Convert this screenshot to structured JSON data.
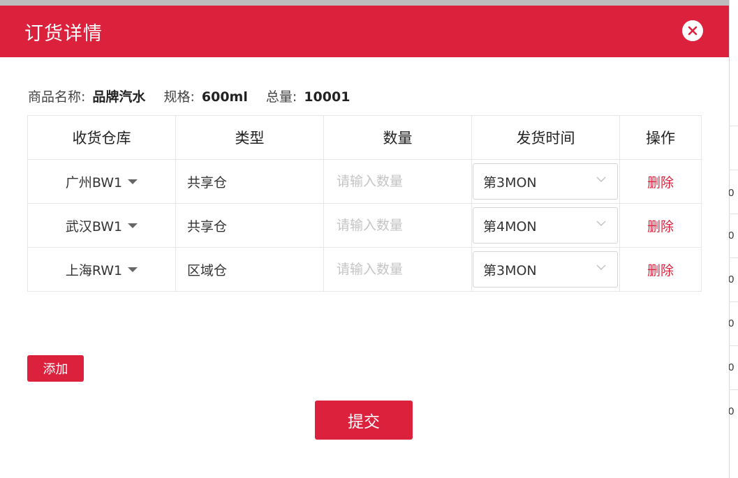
{
  "dialog": {
    "title": "订货详情"
  },
  "product": {
    "name_label": "商品名称:",
    "name_value": "品牌汽水",
    "spec_label": "规格:",
    "spec_value": "600ml",
    "total_label": "总量:",
    "total_value": "10001"
  },
  "table": {
    "headers": [
      "收货仓库",
      "类型",
      "数量",
      "发货时间",
      "操作"
    ],
    "rows": [
      {
        "warehouse": "广州BW1",
        "type": "共享仓",
        "qty_placeholder": "请输入数量",
        "ship_time": "第3MON",
        "action": "删除"
      },
      {
        "warehouse": "武汉BW1",
        "type": "共享仓",
        "qty_placeholder": "请输入数量",
        "ship_time": "第4MON",
        "action": "删除"
      },
      {
        "warehouse": "上海RW1",
        "type": "区域仓",
        "qty_placeholder": "请输入数量",
        "ship_time": "第3MON",
        "action": "删除"
      }
    ]
  },
  "buttons": {
    "add": "添加",
    "submit": "提交"
  },
  "background_page": {
    "values": [
      "0",
      "0",
      "0",
      "0",
      "0",
      "0"
    ]
  },
  "colors": {
    "accent": "#dc213d"
  },
  "icons": {
    "close": "close-icon",
    "caret": "caret-down-icon",
    "chevron": "chevron-down-icon"
  }
}
